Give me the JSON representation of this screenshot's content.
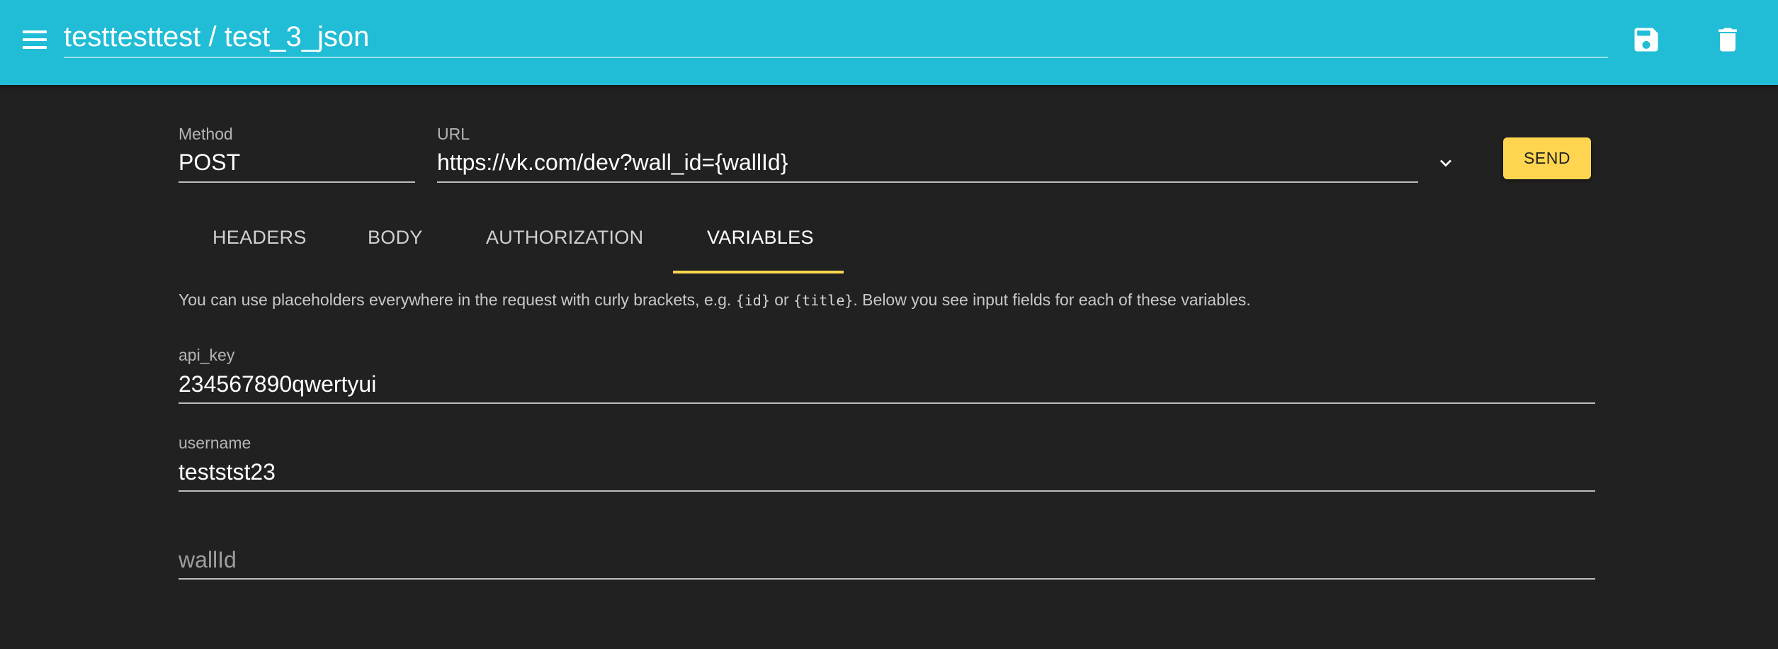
{
  "header": {
    "title": "testtesttest / test_3_json",
    "icons": {
      "menu": "menu-icon",
      "save": "save-icon",
      "delete": "delete-icon"
    },
    "background_color": "#21bcd5"
  },
  "request": {
    "method_label": "Method",
    "method_value": "POST",
    "url_label": "URL",
    "url_value": "https://vk.com/dev?wall_id={wallId}",
    "send_label": "SEND",
    "accent_color": "#ffd54f"
  },
  "tabs": [
    {
      "label": "HEADERS",
      "active": false
    },
    {
      "label": "BODY",
      "active": false
    },
    {
      "label": "AUTHORIZATION",
      "active": false
    },
    {
      "label": "VARIABLES",
      "active": true
    }
  ],
  "variables": {
    "info_prefix": "You can use placeholders everywhere in the request with curly brackets, e.g. ",
    "info_code_1": "{id}",
    "info_middle": " or ",
    "info_code_2": "{title}",
    "info_suffix": ". Below you see input fields for each of these variables.",
    "fields": [
      {
        "label": "api_key",
        "value": "234567890qwertyui"
      },
      {
        "label": "username",
        "value": "teststst23"
      },
      {
        "label": "",
        "value": "",
        "placeholder": "wallId"
      }
    ]
  }
}
